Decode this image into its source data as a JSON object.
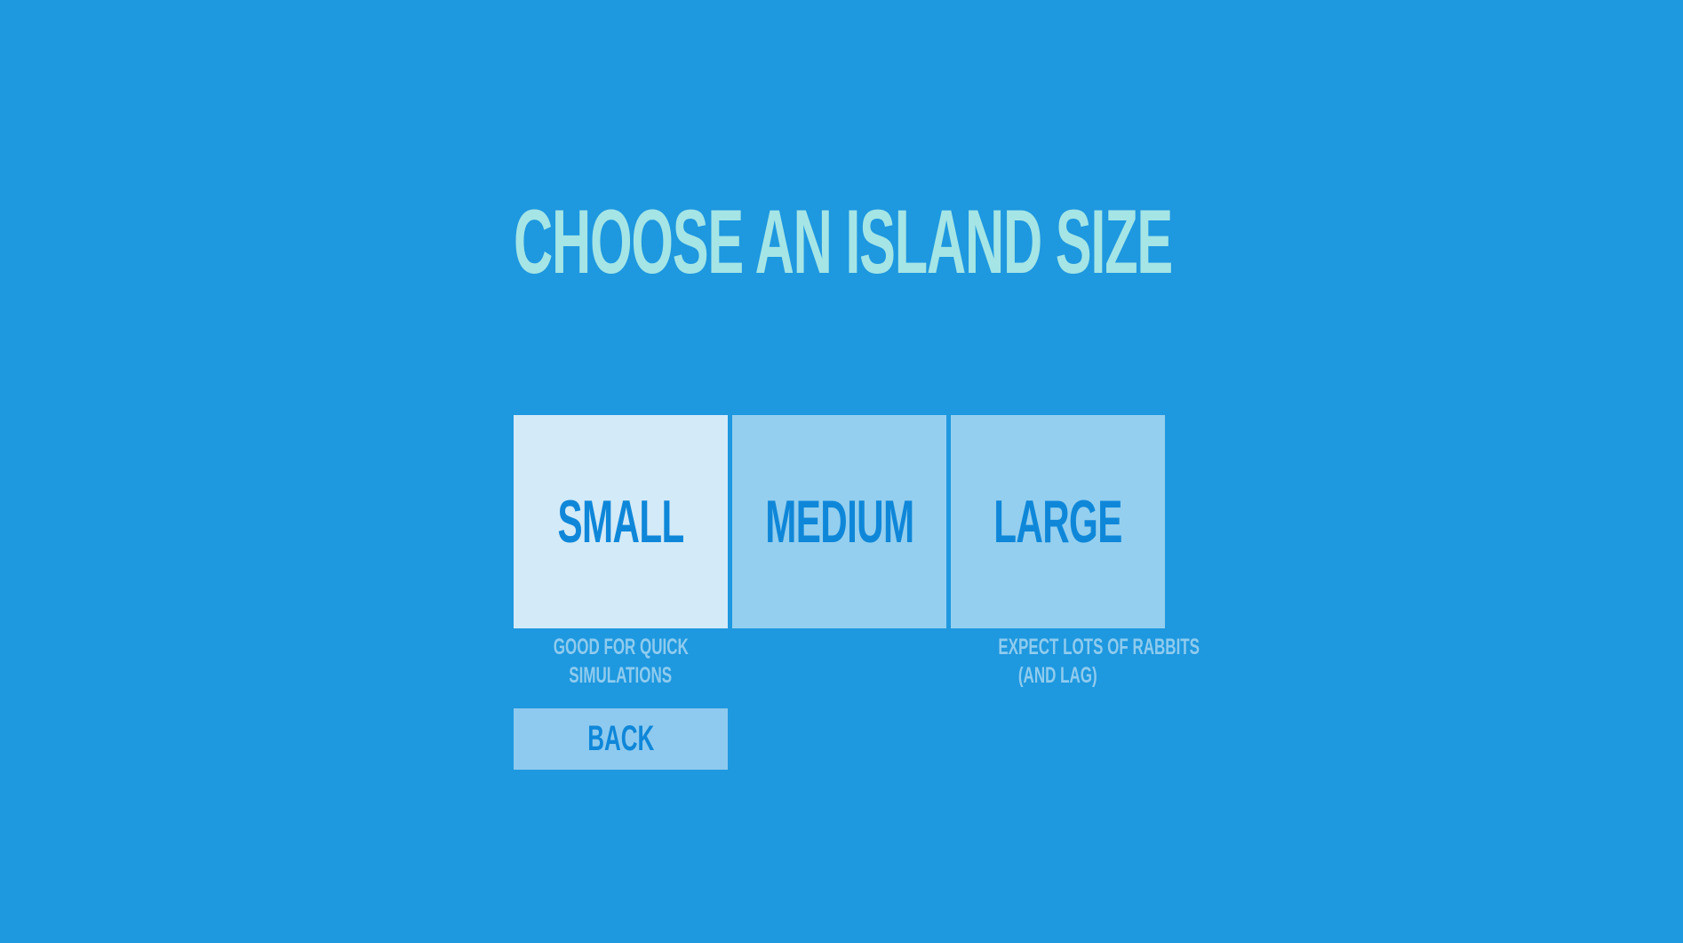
{
  "title": "CHOOSE AN ISLAND SIZE",
  "sizes": [
    {
      "label": "SMALL",
      "description_line1": "GOOD FOR QUICK",
      "description_line2": "SIMULATIONS",
      "selected": true
    },
    {
      "label": "MEDIUM",
      "description_line1": "",
      "description_line2": "",
      "selected": false
    },
    {
      "label": "LARGE",
      "description_line1": "EXPECT LOTS OF RABBITS",
      "description_line2": "(AND LAG)",
      "selected": false
    }
  ],
  "back_label": "BACK",
  "colors": {
    "background": "#1e98df",
    "title": "#a5e5e6",
    "button": "#94cfef",
    "button_selected": "#d3eaf8",
    "button_text": "#0f87d9",
    "description": "#8fcbee"
  }
}
